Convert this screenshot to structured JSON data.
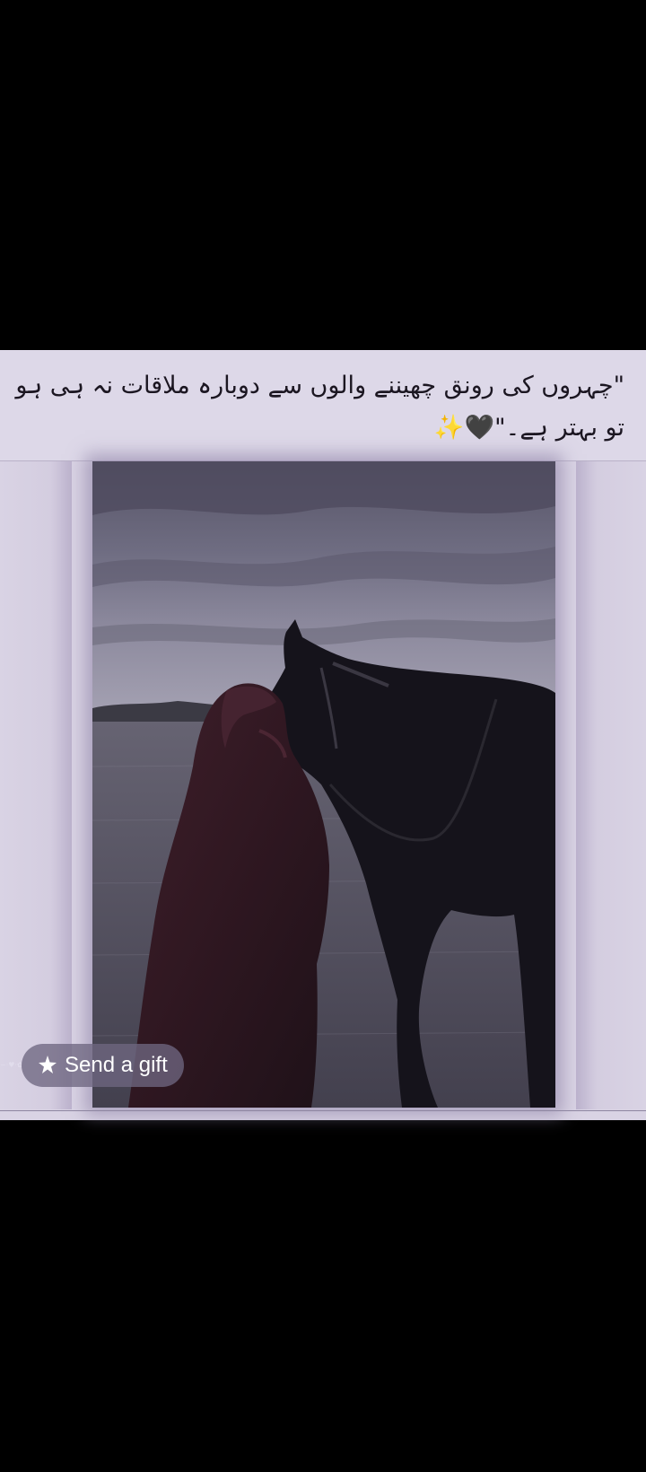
{
  "post": {
    "caption": "\"چہروں کی رونق چھیننے والوں سے دوبارہ ملاقات نہ ہی ہو تو بہتر ہے۔\"🖤✨"
  },
  "gift": {
    "label": "Send a gift",
    "icon": "gift-sparkle-icon"
  },
  "colors": {
    "background": "#000000",
    "post_background": "#ddd8e8",
    "caption_text": "#1b1621",
    "gift_pill": "#6e6680"
  }
}
